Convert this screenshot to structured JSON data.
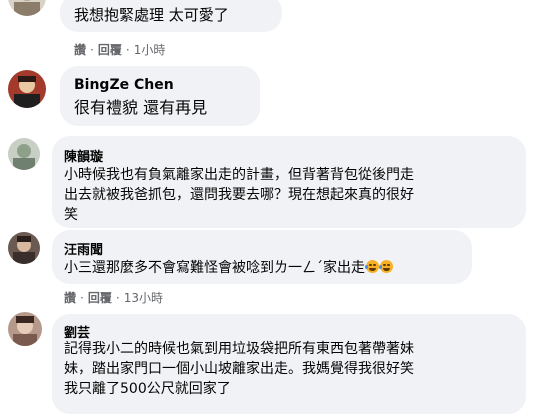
{
  "comments": [
    {
      "author": "",
      "text": "我想抱緊處理 太可愛了",
      "actions": {
        "like": "讚",
        "reply": "回覆",
        "time": "1小時"
      }
    },
    {
      "author": "BingZe Chen",
      "text": "很有禮貌 還有再見"
    },
    {
      "author": "陳韻璇",
      "text": "小時候我也有負氣離家出走的計畫，但背著背包從後門走\n出去就被我爸抓包，還問我要去哪？現在想起來真的很好\n笑"
    },
    {
      "author": "汪雨聞",
      "text": "小三還那麼多不會寫難怪會被唸到ㄌ一ㄥˊ家出走",
      "emojis": [
        "laughing-tears-emoji",
        "laughing-tears-emoji"
      ],
      "actions": {
        "like": "讚",
        "reply": "回覆",
        "time": "13小時"
      }
    },
    {
      "author": "劉芸",
      "text": "記得我小二的時候也氣到用垃圾袋把所有東西包著帶著妹\n妹，踏出家門口一個小山坡離家出走。我媽覺得我很好笑\n我只離了500公尺就回家了"
    }
  ],
  "colors": {
    "bubble": "#f0f2f5",
    "text": "#050505",
    "secondary": "#65676b"
  }
}
